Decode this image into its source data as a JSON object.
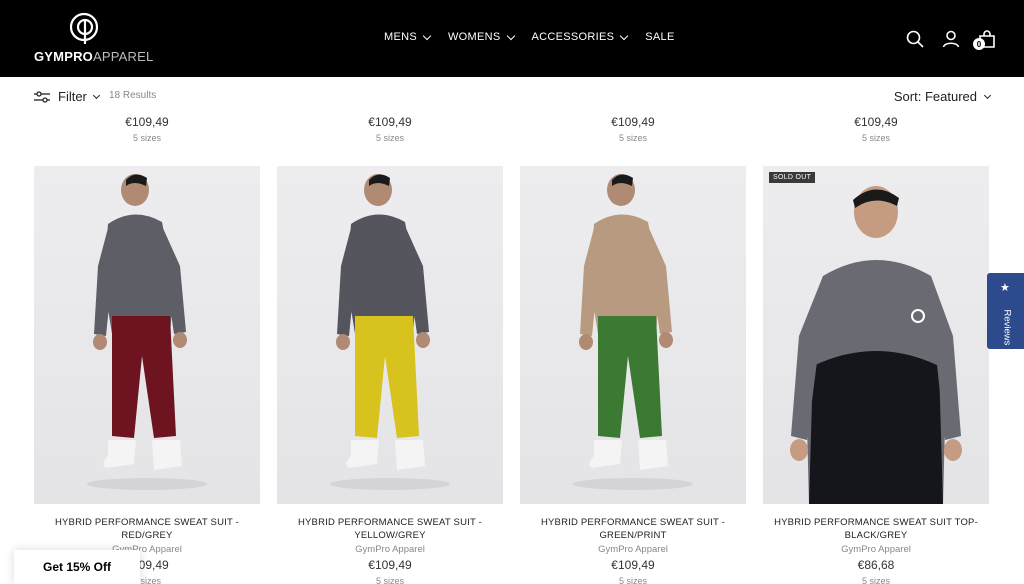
{
  "header": {
    "logo_text_bold": "GYMPRO",
    "logo_text_light": "APPAREL",
    "nav": [
      {
        "label": "MENS",
        "has_dropdown": true
      },
      {
        "label": "WOMENS",
        "has_dropdown": true
      },
      {
        "label": "ACCESSORIES",
        "has_dropdown": true
      },
      {
        "label": "SALE",
        "has_dropdown": false
      }
    ],
    "cart_count": "0",
    "icons": [
      "search-icon",
      "account-icon",
      "cart-icon"
    ]
  },
  "toolbar": {
    "filter_label": "Filter",
    "results": "18 Results",
    "sort_label": "Sort: Featured"
  },
  "previous_row": [
    {
      "price": "€109,49",
      "sizes": "5 sizes"
    },
    {
      "price": "€109,49",
      "sizes": "5 sizes"
    },
    {
      "price": "€109,49",
      "sizes": "5 sizes"
    },
    {
      "price": "€109,49",
      "sizes": "5 sizes"
    }
  ],
  "products": [
    {
      "title": "HYBRID PERFORMANCE SWEAT SUIT - RED/GREY",
      "vendor": "GymPro Apparel",
      "price": "€109,49",
      "sizes": "5 sizes",
      "badge": "",
      "top_color": "#5e5e66",
      "bottom_color": "#6e1420"
    },
    {
      "title": "HYBRID PERFORMANCE SWEAT SUIT - YELLOW/GREY",
      "vendor": "GymPro Apparel",
      "price": "€109,49",
      "sizes": "5 sizes",
      "badge": "",
      "top_color": "#55555e",
      "bottom_color": "#d8c21e"
    },
    {
      "title": "HYBRID PERFORMANCE SWEAT SUIT - GREEN/PRINT",
      "vendor": "GymPro Apparel",
      "price": "€109,49",
      "sizes": "5 sizes",
      "badge": "",
      "top_color": "#b89a80",
      "bottom_color": "#3c7a34"
    },
    {
      "title": "HYBRID PERFORMANCE SWEAT SUIT TOP- BLACK/GREY",
      "vendor": "GymPro Apparel",
      "price": "€86,68",
      "sizes": "5 sizes",
      "badge": "SOLD OUT",
      "top_color": "#6a6a72",
      "bottom_color": "#15151c"
    }
  ],
  "reviews_tab": {
    "label": "Reviews",
    "icon": "star-icon",
    "color": "#2c4a8c"
  },
  "discount": {
    "label": "Get 15% Off"
  }
}
